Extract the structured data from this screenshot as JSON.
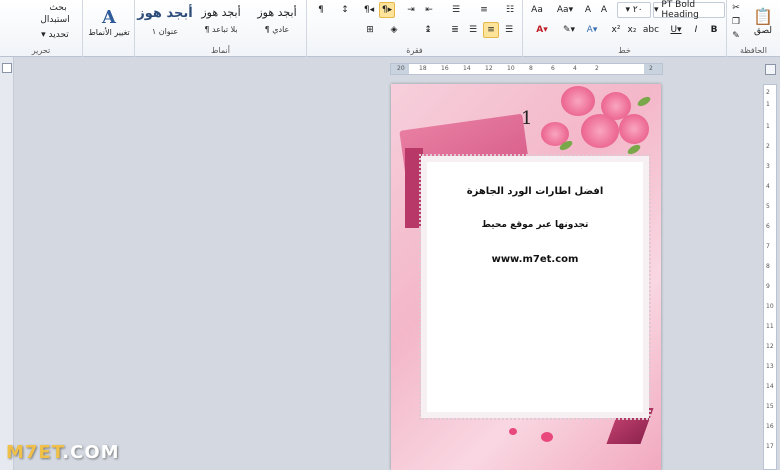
{
  "ribbon": {
    "editing": {
      "group_label": "تحرير",
      "find_label": "بحث",
      "replace_label": "استبدال",
      "select_label": "تحديد"
    },
    "styles": {
      "group_label": "أنماط",
      "change_styles_label": "تغيير الأنماط",
      "items": [
        {
          "sample": "أبجد هوز",
          "name": "عنوان ١"
        },
        {
          "sample": "أبجد هوز",
          "name": "¶ بلا تباعد"
        },
        {
          "sample": "أبجد هوز",
          "name": "¶ عادي"
        }
      ]
    },
    "paragraph": {
      "group_label": "فقرة"
    },
    "font": {
      "group_label": "خط",
      "font_name": "PT Bold Heading",
      "font_size": "٢٠"
    },
    "clipboard": {
      "group_label": "الحافظة",
      "paste_label": "لصق"
    }
  },
  "ruler": {
    "top_numbers": [
      "20",
      "18",
      "16",
      "14",
      "12",
      "10",
      "8",
      "6",
      "4",
      "2",
      "2"
    ],
    "side_numbers": [
      "2",
      "1",
      "1",
      "2",
      "3",
      "4",
      "5",
      "6",
      "7",
      "8",
      "9",
      "10",
      "11",
      "12",
      "13",
      "14",
      "15",
      "16",
      "17"
    ]
  },
  "document": {
    "page_number": "1",
    "title": "افضل اطارات الورد الجاهزة",
    "subtitle": "تجدونها عبر موقع محيط",
    "url": "www.m7et.com"
  },
  "watermark": {
    "prefix": "M7ET",
    "suffix": ".COM"
  }
}
